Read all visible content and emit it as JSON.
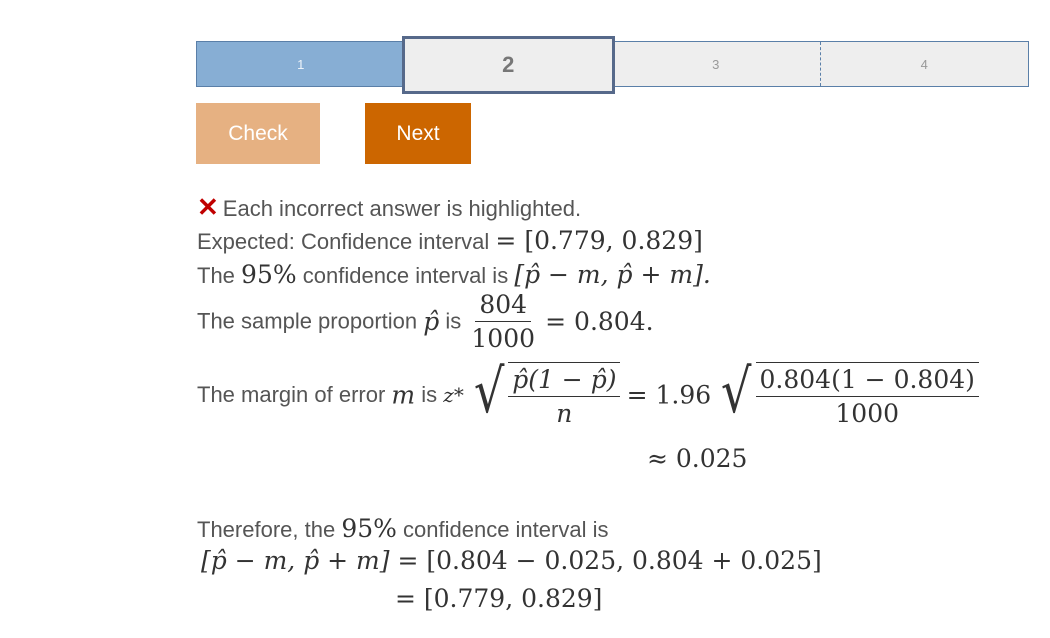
{
  "progress": {
    "segments": [
      {
        "label": "1",
        "state": "done"
      },
      {
        "label": "2",
        "state": "current"
      },
      {
        "label": "3",
        "state": "todo"
      },
      {
        "label": "4",
        "state": "todo"
      }
    ]
  },
  "buttons": {
    "check_label": "Check",
    "next_label": "Next"
  },
  "feedback": {
    "status_icon": "x-mark-icon",
    "status_text": "Each incorrect answer is highlighted.",
    "expected_prefix": "Expected: Confidence interval",
    "expected_value": "= [0.779, 0.829]"
  },
  "explanation": {
    "line1_pre": "The",
    "line1_pct": "95%",
    "line1_mid": "confidence interval is",
    "line1_math": "[p̂ − m, p̂ + m].",
    "line2_pre": "The sample proportion",
    "line2_var": "p̂",
    "line2_mid": "is",
    "line2_num": "804",
    "line2_den": "1000",
    "line2_result": "= 0.804.",
    "line3_pre": "The margin of error",
    "line3_var": "m",
    "line3_mid": "is",
    "line3_z": "z*",
    "line3_frac_num": "p̂(1 − p̂)",
    "line3_frac_den": "n",
    "line3_eq": "= 1.96",
    "line3_frac2_num": "0.804(1 − 0.804)",
    "line3_frac2_den": "1000",
    "line3_approx": "≈ 0.025",
    "line4_pre": "Therefore, the",
    "line4_pct": "95%",
    "line4_post": "confidence interval is",
    "line5_lhs": "[p̂ − m, p̂ + m]",
    "line5_rhs": "= [0.804 − 0.025, 0.804 + 0.025]",
    "line6_rhs": "= [0.779, 0.829]"
  }
}
